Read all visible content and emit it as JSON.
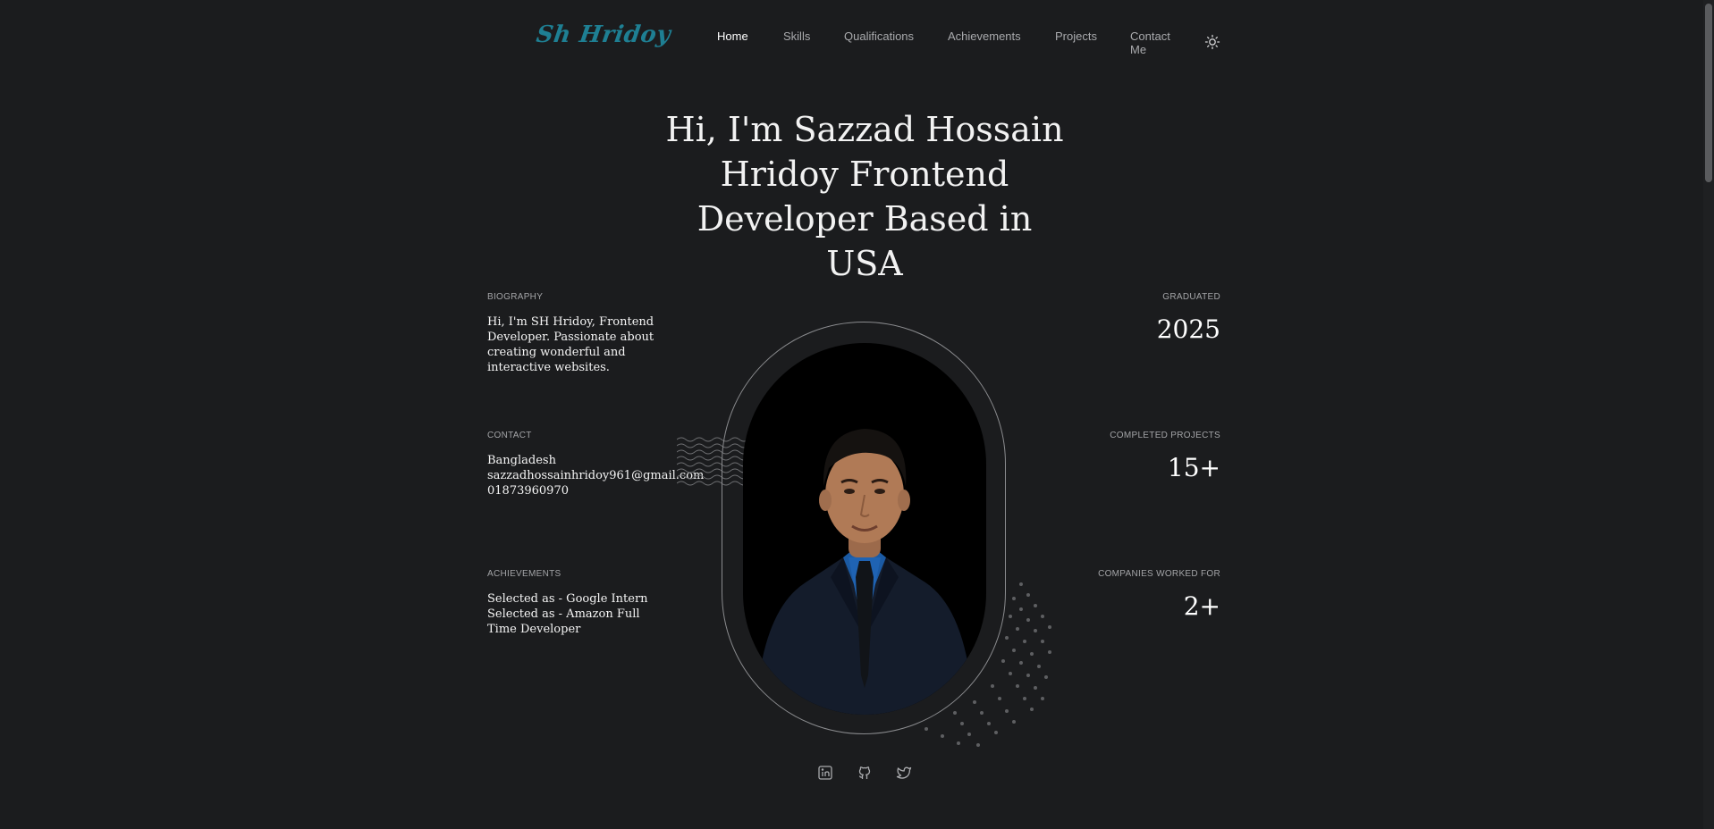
{
  "nav": {
    "logo": "Sh Hridoy",
    "items": [
      {
        "label": "Home",
        "active": true
      },
      {
        "label": "Skills",
        "active": false
      },
      {
        "label": "Qualifications",
        "active": false
      },
      {
        "label": "Achievements",
        "active": false
      },
      {
        "label": "Projects",
        "active": false
      },
      {
        "label": "Contact Me",
        "active": false
      }
    ],
    "theme_icon": "sun-icon"
  },
  "hero": {
    "title": "Hi, I'm Sazzad Hossain Hridoy Frontend Developer Based in USA"
  },
  "biography": {
    "label": "BIOGRAPHY",
    "text": "Hi, I'm SH Hridoy, Frontend Developer. Passionate about creating wonderful and interactive websites."
  },
  "contact": {
    "label": "CONTACT",
    "country": "Bangladesh",
    "email": "sazzadhossainhridoy961@gmail.com",
    "phone": "01873960970"
  },
  "achievements": {
    "label": "ACHIEVEMENTS",
    "lines": [
      "Selected as - Google Intern",
      "Selected as - Amazon Full Time Developer"
    ]
  },
  "stats": {
    "graduated_label": "GRADUATED",
    "graduated_value": "2025",
    "projects_label": "COMPLETED PROJECTS",
    "projects_value": "15+",
    "companies_label": "COMPANIES WORKED FOR",
    "companies_value": "2+"
  },
  "social": [
    "linkedin-icon",
    "github-icon",
    "twitter-icon"
  ],
  "colors": {
    "background": "#1b1c1e",
    "logo": "#1e7f93",
    "text": "#ffffff",
    "muted": "#a9aaad"
  }
}
